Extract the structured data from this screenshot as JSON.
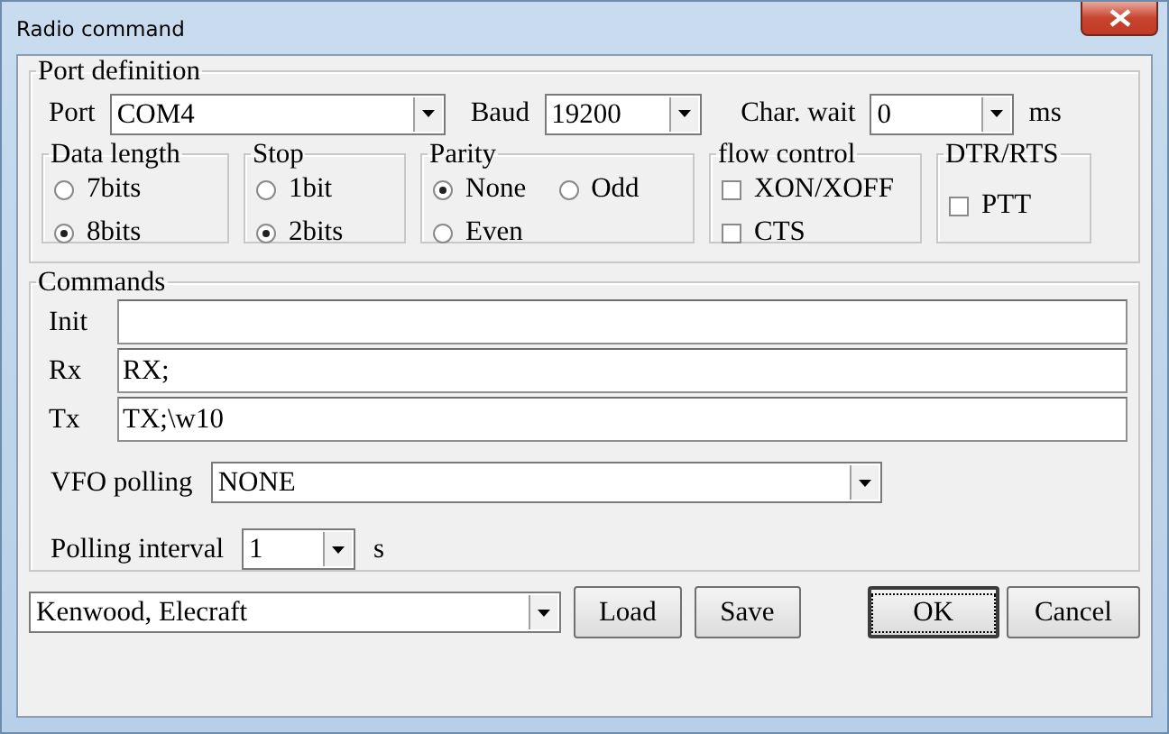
{
  "window": {
    "title": "Radio command"
  },
  "port_definition": {
    "title": "Port definition",
    "port": {
      "label": "Port",
      "value": "COM4"
    },
    "baud": {
      "label": "Baud",
      "value": "19200"
    },
    "char_wait": {
      "label": "Char. wait",
      "value": "0",
      "unit": "ms"
    },
    "groups": [
      {
        "title": "Data length",
        "rows": [
          [
            {
              "kind": "radio",
              "label": "7bits",
              "selected": false
            }
          ],
          [
            {
              "kind": "radio",
              "label": "8bits",
              "selected": true
            }
          ]
        ]
      },
      {
        "title": "Stop",
        "rows": [
          [
            {
              "kind": "radio",
              "label": "1bit",
              "selected": false
            }
          ],
          [
            {
              "kind": "radio",
              "label": "2bits",
              "selected": true
            }
          ]
        ]
      },
      {
        "title": "Parity",
        "rows": [
          [
            {
              "kind": "radio",
              "label": "None",
              "selected": true
            },
            {
              "kind": "radio",
              "label": "Odd",
              "selected": false
            }
          ],
          [
            {
              "kind": "radio",
              "label": "Even",
              "selected": false
            }
          ]
        ]
      },
      {
        "title": "flow control",
        "rows": [
          [
            {
              "kind": "checkbox",
              "label": "XON/XOFF",
              "checked": false
            }
          ],
          [
            {
              "kind": "checkbox",
              "label": "CTS",
              "checked": false
            }
          ]
        ]
      },
      {
        "title": "DTR/RTS",
        "rows": [
          [
            {
              "kind": "checkbox",
              "label": "PTT",
              "checked": false
            }
          ]
        ]
      }
    ]
  },
  "commands": {
    "title": "Commands",
    "fields": [
      {
        "label": "Init"
      },
      {
        "label": "Rx",
        "value": "RX;"
      },
      {
        "label": "Tx",
        "value": "TX;\\w10"
      }
    ],
    "vfo_polling": {
      "label": "VFO polling",
      "value": "NONE"
    },
    "polling_interval": {
      "label": "Polling interval",
      "value": "1",
      "unit": "s"
    }
  },
  "footer": {
    "preset": "Kenwood, Elecraft",
    "buttons": [
      {
        "label": "Load",
        "focused": false
      },
      {
        "label": "Save",
        "focused": false
      },
      {
        "label": "OK",
        "focused": true
      },
      {
        "label": "Cancel",
        "focused": false
      }
    ]
  }
}
